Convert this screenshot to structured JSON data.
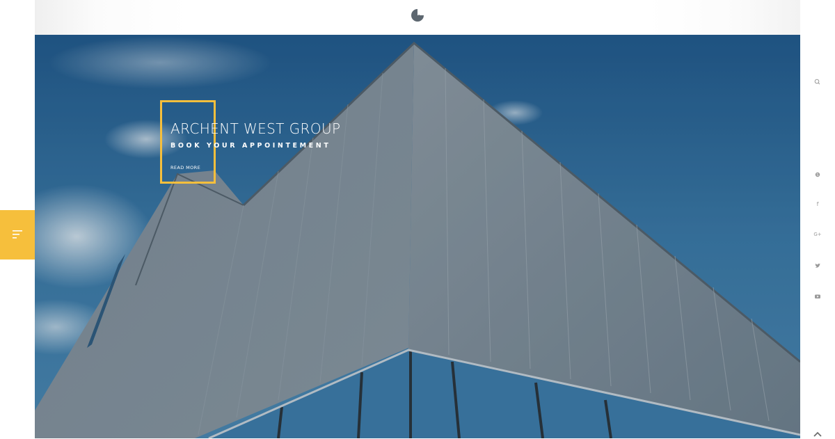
{
  "header": {
    "logo_icon": "brand-logo-icon"
  },
  "hero": {
    "title": "ARCHENT WEST GROUP",
    "subtitle": "BOOK YOUR APPOINTEMENT",
    "link_label": "READ MORE",
    "accent_color": "#f6bf3c",
    "background_description_icon": "building-photo"
  },
  "sidebar_left": {
    "menu_icon": "menu-lines-icon"
  },
  "sidebar_right": {
    "search_icon": "search-icon",
    "social": [
      {
        "name": "skype-icon"
      },
      {
        "name": "facebook-icon",
        "glyph": "f"
      },
      {
        "name": "google-plus-icon",
        "glyph": "G+"
      },
      {
        "name": "twitter-icon"
      },
      {
        "name": "youtube-icon"
      }
    ],
    "scroll_top_icon": "chevron-up-icon"
  }
}
